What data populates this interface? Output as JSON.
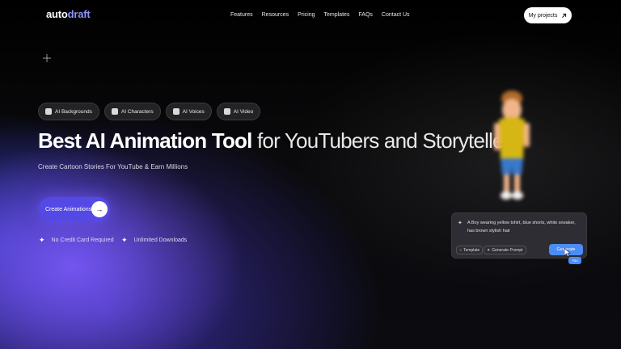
{
  "header": {
    "logo_part1": "auto",
    "logo_part2": "draft",
    "nav": [
      "Features",
      "Resources",
      "Pricing",
      "Templates",
      "FAQs",
      "Contact Us"
    ],
    "projects_label": "My projects"
  },
  "hero": {
    "pills": [
      {
        "label": "AI Backgrounds",
        "icon": "image-icon"
      },
      {
        "label": "AI Characters",
        "icon": "character-icon"
      },
      {
        "label": "AI Voices",
        "icon": "voice-icon"
      },
      {
        "label": "AI Video",
        "icon": "video-icon"
      }
    ],
    "headline_strong": "Best AI Animation Tool",
    "headline_light": "for YouTubers and Storytellers",
    "subline": "Create Cartoon Stories For YouTube & Earn Millions",
    "cta_label": "Create Animations",
    "features": [
      "No Credit Card Required",
      "Unlimited Downloads"
    ]
  },
  "generator": {
    "prompt": "A Boy wearing yellow tshirt, blue shorts, white sneaker, has brown stylish hair",
    "template_label": "Template",
    "generate_prompt_label": "Generate Prompt",
    "generate_label": "Generate",
    "cursor_tag": "You"
  },
  "colors": {
    "accent": "#5449e4",
    "logo_accent": "#8f93ff",
    "generate_button": "#4c8cf6"
  }
}
